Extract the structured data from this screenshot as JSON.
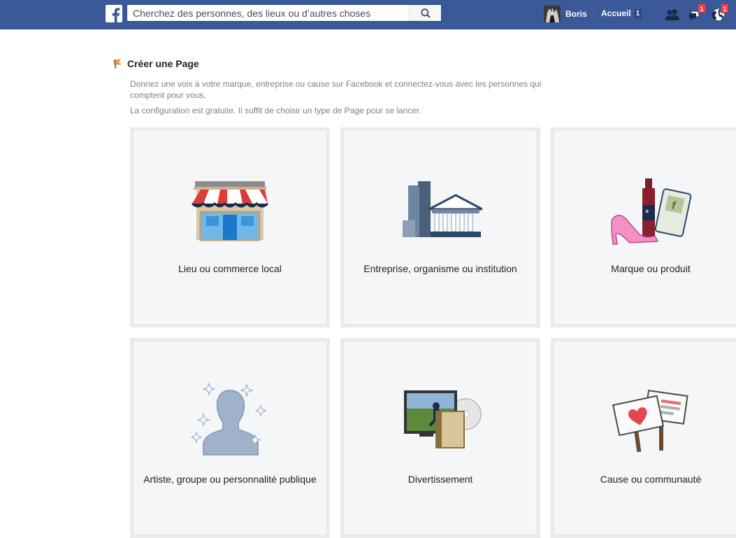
{
  "topbar": {
    "search_placeholder": "Cherchez des personnes, des lieux ou d’autres choses",
    "profile_name": "Boris",
    "home_label": "Accueil",
    "home_count": "1",
    "friend_requests_count": "",
    "messages_count": "1",
    "notifications_count": "1",
    "brand_color": "#3b5998",
    "badge_color": "#fa3e3e"
  },
  "page": {
    "title": "Créer une Page",
    "description_1": "Donnez une voix à votre marque, entreprise ou cause sur Facebook et connectez-vous avec les personnes qui comptent pour vous.",
    "description_2": "La configuration est gratuite. Il suffit de choisir un type de Page pour se lancer."
  },
  "categories": [
    {
      "label": "Lieu ou commerce local",
      "icon": "storefront-icon"
    },
    {
      "label": "Entreprise, organisme ou institution",
      "icon": "buildings-icon"
    },
    {
      "label": "Marque ou produit",
      "icon": "products-icon"
    },
    {
      "label": "Artiste, groupe ou personnalité publique",
      "icon": "artist-silhouette-icon"
    },
    {
      "label": "Divertissement",
      "icon": "entertainment-icon"
    },
    {
      "label": "Cause ou communauté",
      "icon": "protest-signs-icon"
    }
  ]
}
